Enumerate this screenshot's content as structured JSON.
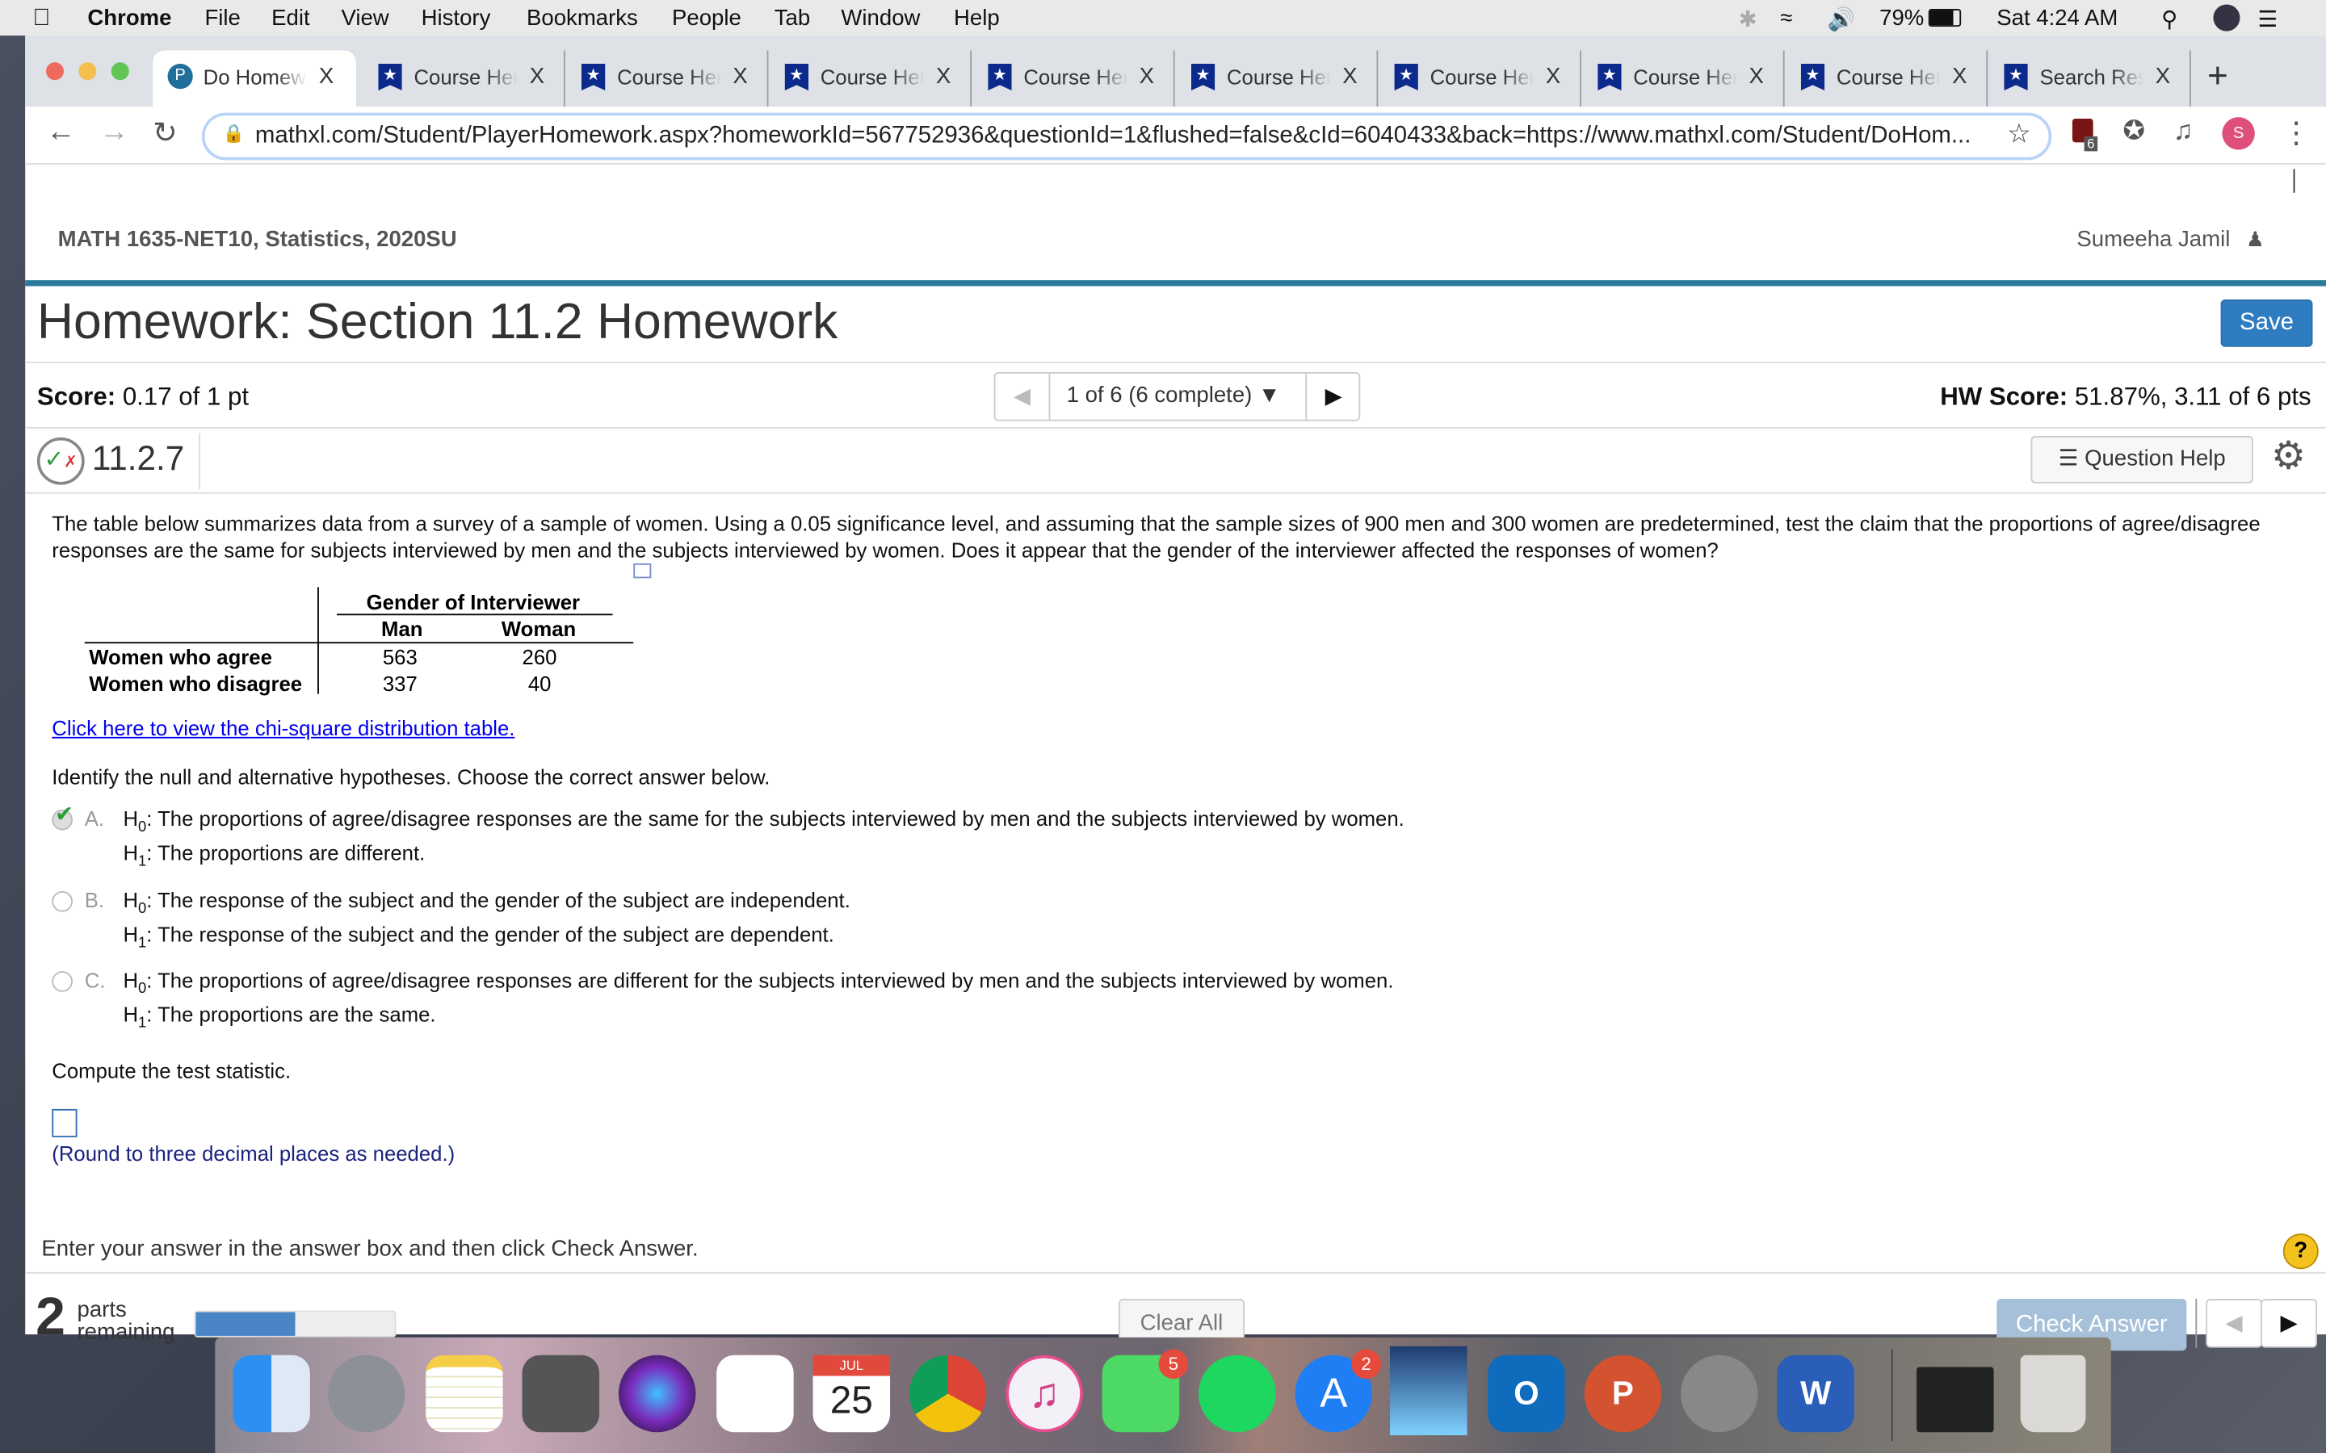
{
  "menubar": {
    "apple": "",
    "items": [
      "Chrome",
      "File",
      "Edit",
      "View",
      "History",
      "Bookmarks",
      "People",
      "Tab",
      "Window",
      "Help"
    ],
    "battery": "79%",
    "clock": "Sat 4:24 AM"
  },
  "tabs": [
    {
      "label": "Do Homework",
      "active": true
    },
    {
      "label": "Course Hero"
    },
    {
      "label": "Course Hero"
    },
    {
      "label": "Course Hero"
    },
    {
      "label": "Course Hero"
    },
    {
      "label": "Course Hero"
    },
    {
      "label": "Course Hero"
    },
    {
      "label": "Course Hero"
    },
    {
      "label": "Course Hero"
    },
    {
      "label": "Search Results"
    }
  ],
  "tab_close": "X",
  "new_tab": "+",
  "address": {
    "url": "mathxl.com/Student/PlayerHomework.aspx?homeworkId=567752936&questionId=1&flushed=false&cId=6040433&back=https://www.mathxl.com/Student/DoHom...",
    "ext_badge": "6",
    "profile": "S"
  },
  "course": {
    "title": "MATH 1635-NET10, Statistics, 2020SU",
    "user": "Sumeeha Jamil"
  },
  "homework": {
    "title": "Homework: Section 11.2 Homework",
    "save": "Save",
    "score_label": "Score:",
    "score": "0.17 of 1 pt",
    "pager": "1 of 6 (6 complete)",
    "hw_score_label": "HW Score:",
    "hw_score": "51.87%, 3.11 of 6 pts"
  },
  "question": {
    "number": "11.2.7",
    "help": "Question Help",
    "text": "The table below summarizes data from a survey of a sample of women. Using a 0.05 significance level, and assuming that the sample sizes of 900 men and 300 women are predetermined, test the claim that the proportions of agree/disagree responses are the same for subjects interviewed by men and the subjects interviewed by women. Does it appear that the gender of the interviewer affected the responses of women?",
    "table": {
      "group_header": "Gender of Interviewer",
      "columns": [
        "Man",
        "Woman"
      ],
      "rows": [
        {
          "label": "Women who agree",
          "values": [
            "563",
            "260"
          ]
        },
        {
          "label": "Women who disagree",
          "values": [
            "337",
            "40"
          ]
        }
      ]
    },
    "link": "Click here to view the chi-square distribution table.",
    "part1": "Identify the null and alternative hypotheses. Choose the correct answer below.",
    "options": [
      {
        "letter": "A.",
        "h0": "The proportions of agree/disagree responses are the same for the subjects interviewed by men and the subjects interviewed by women.",
        "h1": "The proportions are different.",
        "selected": true
      },
      {
        "letter": "B.",
        "h0": "The response of the subject and the gender of the subject are independent.",
        "h1": "The response of the subject and the gender of the subject are dependent.",
        "selected": false
      },
      {
        "letter": "C.",
        "h0": "The proportions of agree/disagree responses are different for the subjects interviewed by men and the subjects interviewed by women.",
        "h1": "The proportions are the same.",
        "selected": false
      }
    ],
    "h0_prefix": "H",
    "h0_sub": "0",
    "h1_sub": "1",
    "colon": ":",
    "part2": "Compute the test statistic.",
    "answer_value": "",
    "round_note": "(Round to three decimal places as needed.)"
  },
  "footer": {
    "instruction": "Enter your answer in the answer box and then click Check Answer.",
    "parts_count": "2",
    "parts_word1": "parts",
    "parts_word2": "remaining",
    "progress": 0.5,
    "clear_all": "Clear All",
    "check_answer": "Check Answer",
    "help": "?"
  },
  "dock": {
    "calendar_month": "JUL",
    "calendar_day": "25",
    "facetime_badge": "5",
    "appstore_badge": "2"
  },
  "colors": {
    "accent": "#2f7cc1",
    "teal": "#2a7b9b",
    "link": "#0000ee",
    "note": "#1a237e"
  }
}
